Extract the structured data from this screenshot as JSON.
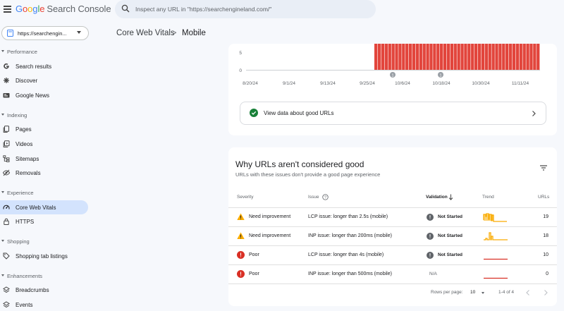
{
  "header": {
    "logo_google": "Google",
    "logo_product": "Search Console",
    "search_placeholder": "Inspect any URL in \"https://searchengineland.com/\""
  },
  "sidebar": {
    "property": "https://searchengin...",
    "sections": [
      {
        "label": "Performance"
      },
      {
        "label": "Indexing"
      },
      {
        "label": "Experience"
      },
      {
        "label": "Shopping"
      },
      {
        "label": "Enhancements"
      }
    ],
    "items": [
      {
        "label": "Search results",
        "icon": "google-g-icon"
      },
      {
        "label": "Discover",
        "icon": "asterisk-icon"
      },
      {
        "label": "Google News",
        "icon": "news-icon"
      },
      {
        "label": "Pages",
        "icon": "pages-icon"
      },
      {
        "label": "Videos",
        "icon": "video-pages-icon"
      },
      {
        "label": "Sitemaps",
        "icon": "sitemap-icon"
      },
      {
        "label": "Removals",
        "icon": "removals-icon"
      },
      {
        "label": "Core Web Vitals",
        "icon": "gauge-icon",
        "active": true
      },
      {
        "label": "HTTPS",
        "icon": "lock-icon"
      },
      {
        "label": "Shopping tab listings",
        "icon": "tag-icon"
      },
      {
        "label": "Breadcrumbs",
        "icon": "layers-icon"
      },
      {
        "label": "Events",
        "icon": "events-icon"
      }
    ]
  },
  "breadcrumb": {
    "parent": "Core Web Vitals",
    "separator": ">",
    "current": "Mobile"
  },
  "chart_data": {
    "type": "bar",
    "y_ticks": [
      "5",
      "0"
    ],
    "x_ticks": [
      "8/20/24",
      "9/1/24",
      "9/13/24",
      "9/25/24",
      "10/6/24",
      "10/18/24",
      "10/30/24",
      "11/11/24"
    ],
    "series_color": "#e2453c",
    "annotations": [
      "1",
      "1"
    ]
  },
  "good_urls_link": "View data about good URLs",
  "issues": {
    "title": "Why URLs aren't considered good",
    "subtitle": "URLs with these issues don't provide a good page experience",
    "columns": {
      "severity": "Severity",
      "issue": "Issue",
      "validation": "Validation",
      "trend": "Trend",
      "urls": "URLs"
    },
    "rows": [
      {
        "severity": "Need improvement",
        "issue": "LCP issue: longer than 2.5s (mobile)",
        "validation": "Not Started",
        "urls": "19"
      },
      {
        "severity": "Need improvement",
        "issue": "INP issue: longer than 200ms (mobile)",
        "validation": "Not Started",
        "urls": "18"
      },
      {
        "severity": "Poor",
        "issue": "LCP issue: longer than 4s (mobile)",
        "validation": "Not Started",
        "urls": "10"
      },
      {
        "severity": "Poor",
        "issue": "INP issue: longer than 500ms (mobile)",
        "validation": "N/A",
        "urls": "0"
      }
    ],
    "pagination": {
      "rows_per_page_label": "Rows per page:",
      "rows_per_page": "10",
      "range": "1-4 of 4"
    }
  },
  "colors": {
    "warning": "#f9ab00",
    "error": "#d93025",
    "success": "#188038",
    "active_nav": "#d3e3fd"
  }
}
